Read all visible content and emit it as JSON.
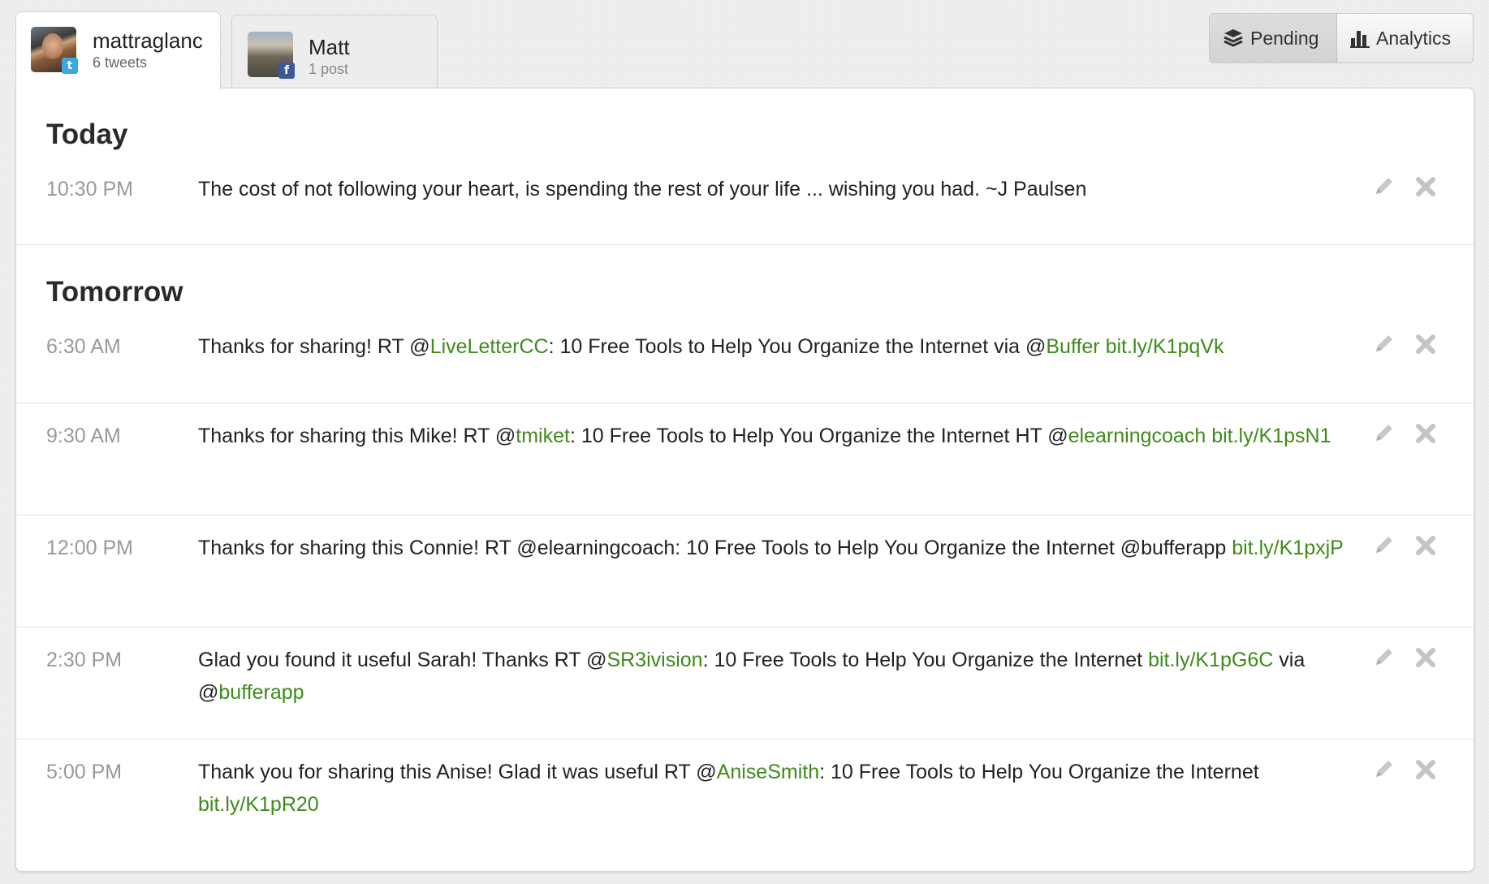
{
  "accounts": [
    {
      "name": "mattraglanc",
      "sub": "6 tweets",
      "network": "twitter",
      "network_badge": "t"
    },
    {
      "name": "Matt",
      "sub": "1 post",
      "network": "facebook",
      "network_badge": "f"
    }
  ],
  "view_toggle": {
    "pending_label": "Pending",
    "analytics_label": "Analytics",
    "selected": "Pending"
  },
  "colors": {
    "link_green": "#3e8a1c",
    "time_gray": "#999999"
  },
  "sections": [
    {
      "title": "Today",
      "posts": [
        {
          "time": "10:30 PM",
          "segments": [
            {
              "t": "The cost of not following your heart, is spending the rest of your life ... wishing you had. ~J Paulsen",
              "link": false
            }
          ]
        }
      ]
    },
    {
      "title": "Tomorrow",
      "posts": [
        {
          "time": "6:30 AM",
          "segments": [
            {
              "t": "Thanks for sharing! RT @",
              "link": false
            },
            {
              "t": "LiveLetterCC",
              "link": true
            },
            {
              "t": ": 10 Free Tools to Help You Organize the Internet via @",
              "link": false
            },
            {
              "t": "Buffer",
              "link": true
            },
            {
              "t": " ",
              "link": false
            },
            {
              "t": "bit.ly/K1pqVk",
              "link": true
            }
          ]
        },
        {
          "time": "9:30 AM",
          "segments": [
            {
              "t": "Thanks for sharing this Mike! RT @",
              "link": false
            },
            {
              "t": "tmiket",
              "link": true
            },
            {
              "t": ": 10 Free Tools to Help You Organize the Internet HT @",
              "link": false
            },
            {
              "t": "elearningcoach",
              "link": true
            },
            {
              "t": " ",
              "link": false
            },
            {
              "t": "bit.ly/K1psN1",
              "link": true
            }
          ]
        },
        {
          "time": "12:00 PM",
          "segments": [
            {
              "t": "Thanks for sharing this Connie! RT @elearningcoach: 10 Free Tools to Help You Organize the Internet @bufferapp ",
              "link": false
            },
            {
              "t": "bit.ly/K1pxjP",
              "link": true
            }
          ]
        },
        {
          "time": "2:30 PM",
          "segments": [
            {
              "t": "Glad you found it useful Sarah! Thanks RT @",
              "link": false
            },
            {
              "t": "SR3ivision",
              "link": true
            },
            {
              "t": ": 10 Free Tools to Help You Organize the Internet ",
              "link": false
            },
            {
              "t": "bit.ly/K1pG6C",
              "link": true
            },
            {
              "t": " via @",
              "link": false
            },
            {
              "t": "bufferapp",
              "link": true
            }
          ]
        },
        {
          "time": "5:00 PM",
          "segments": [
            {
              "t": "Thank you for sharing this Anise! Glad it was useful RT @",
              "link": false
            },
            {
              "t": "AniseSmith",
              "link": true
            },
            {
              "t": ": 10 Free Tools to Help You Organize the Internet ",
              "link": false
            },
            {
              "t": "bit.ly/K1pR20",
              "link": true
            }
          ]
        }
      ]
    }
  ],
  "icons": {
    "edit": "pencil-icon",
    "delete": "close-icon",
    "pending": "layers-icon",
    "analytics": "bar-chart-icon"
  }
}
